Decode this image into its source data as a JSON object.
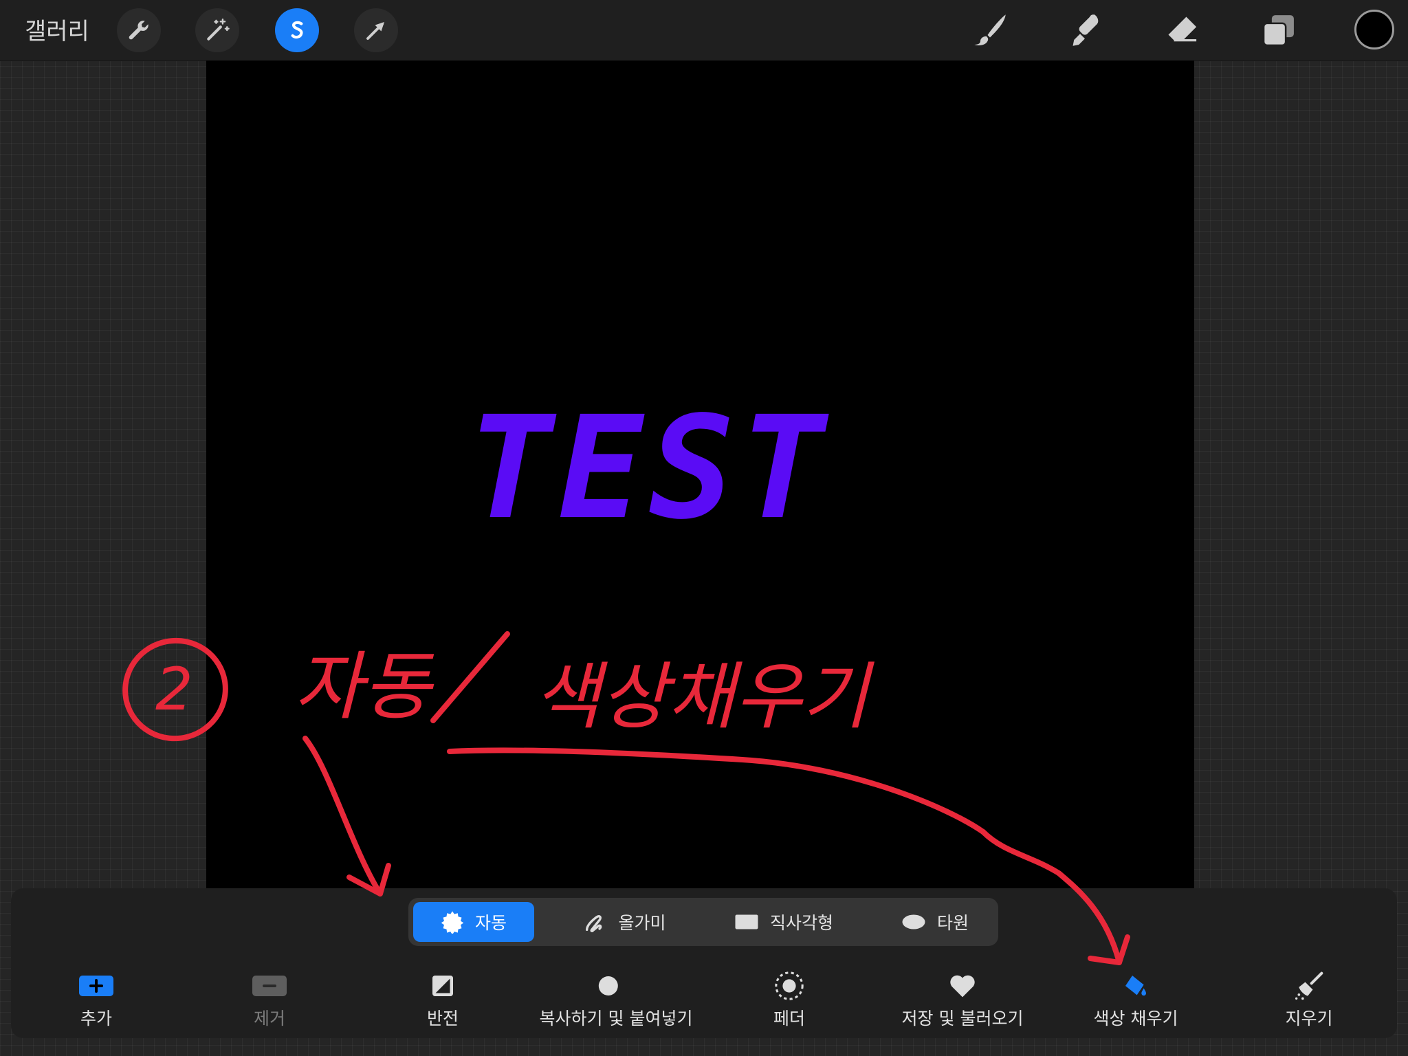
{
  "header": {
    "gallery_label": "갤러리",
    "tools": [
      "wrench-icon",
      "magic-wand-icon",
      "selection-icon",
      "arrow-icon"
    ],
    "right_tools": [
      "brush-icon",
      "smudge-icon",
      "eraser-icon",
      "layers-icon"
    ],
    "current_color": "#000000",
    "accent": "#1a7ef7"
  },
  "canvas": {
    "text": "TEST",
    "text_color": "#5a0cf5"
  },
  "annotation": {
    "number": "2",
    "text_left": "자동",
    "separator": "/",
    "text_right": "색상채우기",
    "color": "#e8283a"
  },
  "selection_modes": [
    {
      "label": "자동",
      "icon": "auto-icon",
      "active": true
    },
    {
      "label": "올가미",
      "icon": "lasso-icon",
      "active": false
    },
    {
      "label": "직사각형",
      "icon": "rectangle-icon",
      "active": false
    },
    {
      "label": "타원",
      "icon": "ellipse-icon",
      "active": false
    }
  ],
  "actions": [
    {
      "label": "추가",
      "icon": "add-icon",
      "enabled": true
    },
    {
      "label": "제거",
      "icon": "remove-icon",
      "enabled": false
    },
    {
      "label": "반전",
      "icon": "invert-icon",
      "enabled": true
    },
    {
      "label": "복사하기 및 붙여넣기",
      "icon": "copy-paste-icon",
      "enabled": true
    },
    {
      "label": "페더",
      "icon": "feather-icon",
      "enabled": true
    },
    {
      "label": "저장 및 불러오기",
      "icon": "heart-icon",
      "enabled": true
    },
    {
      "label": "색상 채우기",
      "icon": "color-fill-icon",
      "enabled": true,
      "active": true
    },
    {
      "label": "지우기",
      "icon": "clear-icon",
      "enabled": true
    }
  ]
}
